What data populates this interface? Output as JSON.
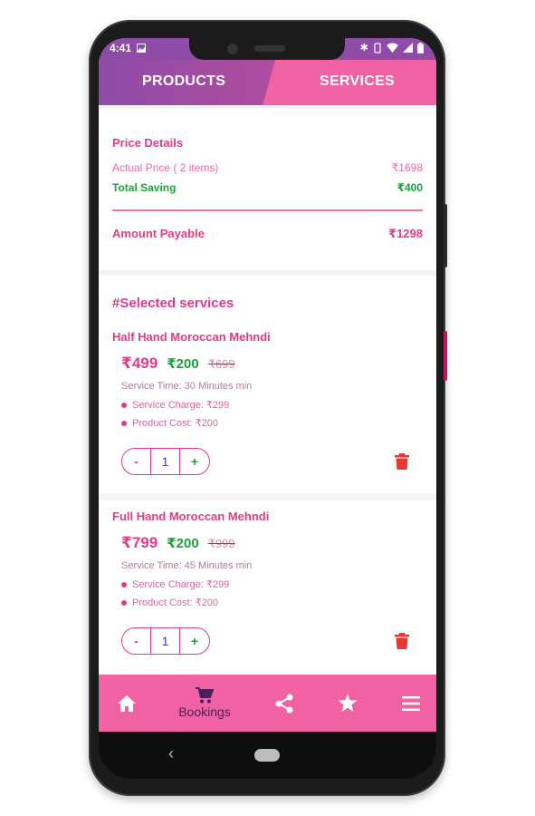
{
  "status_bar": {
    "time": "4:41"
  },
  "tabs": [
    {
      "label": "PRODUCTS"
    },
    {
      "label": "SERVICES"
    }
  ],
  "price_details": {
    "title": "Price Details",
    "actual_label": "Actual Price ( 2 items)",
    "actual_value": "₹1698",
    "saving_label": "Total Saving",
    "saving_value": "₹400",
    "payable_label": "Amount Payable",
    "payable_value": "₹1298"
  },
  "services": {
    "heading": "#Selected services",
    "items": [
      {
        "name": "Half Hand Moroccan Mehndi",
        "price": "₹499",
        "sale_price": "₹200",
        "old_price": "₹699",
        "service_time": "Service Time: 30 Minutes min",
        "service_charge": "Service Charge:  ₹299",
        "product_cost": "Product Cost: ₹200",
        "quantity": "1"
      },
      {
        "name": "Full Hand Moroccan Mehndi",
        "price": "₹799",
        "sale_price": "₹200",
        "old_price": "₹999",
        "service_time": "Service Time: 45 Minutes min",
        "service_charge": "Service Charge:  ₹299",
        "product_cost": "Product Cost: ₹200",
        "quantity": "1"
      }
    ],
    "minus_label": "-",
    "plus_label": "+"
  },
  "bottom_nav": {
    "bookings_label": "Bookings",
    "icons": [
      "home-icon",
      "cart-icon",
      "share-icon",
      "star-icon",
      "menu-icon"
    ]
  },
  "colors": {
    "accent_pink": "#f062a3",
    "purple": "#8e4ba8",
    "text_pink": "#e6398a",
    "green": "#1aa33a",
    "delete_red": "#e53935"
  }
}
